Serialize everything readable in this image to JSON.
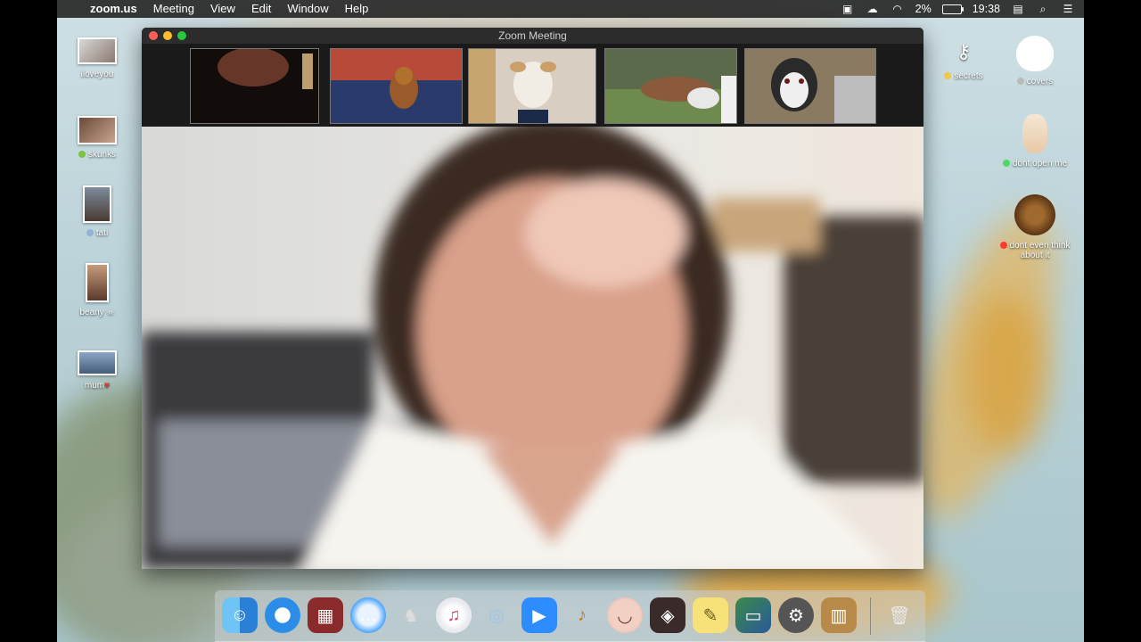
{
  "menubar": {
    "app_name": "zoom.us",
    "menus": [
      "Meeting",
      "View",
      "Edit",
      "Window",
      "Help"
    ],
    "battery": "2%",
    "time": "19:38"
  },
  "zoom_window": {
    "title": "Zoom Meeting"
  },
  "desktop_icons_left": [
    {
      "label": "iloveyou"
    },
    {
      "label": "skunks"
    },
    {
      "label": "tati"
    },
    {
      "label": "beany"
    },
    {
      "label": "mum"
    }
  ],
  "desktop_icons_right": [
    {
      "label": "secrets"
    },
    {
      "label": "covers"
    },
    {
      "label": "dont open me"
    },
    {
      "label": "dont even think about it"
    }
  ],
  "dock": {
    "apps": [
      "finder-icon",
      "safari-icon",
      "photo-booth-icon",
      "messages-icon",
      "launchpad-icon",
      "itunes-icon",
      "preview-icon",
      "zoom-icon",
      "garageband-icon",
      "facetime-icon",
      "photos-icon",
      "stickies-icon",
      "screen-icon",
      "system-preferences-icon",
      "contacts-icon",
      "trash-icon"
    ]
  },
  "colors": {
    "menubar": "#282828",
    "zoom_accent": "#2d8cff",
    "close": "#fd5f57",
    "minimize": "#febc2e",
    "zoom": "#28c840"
  }
}
